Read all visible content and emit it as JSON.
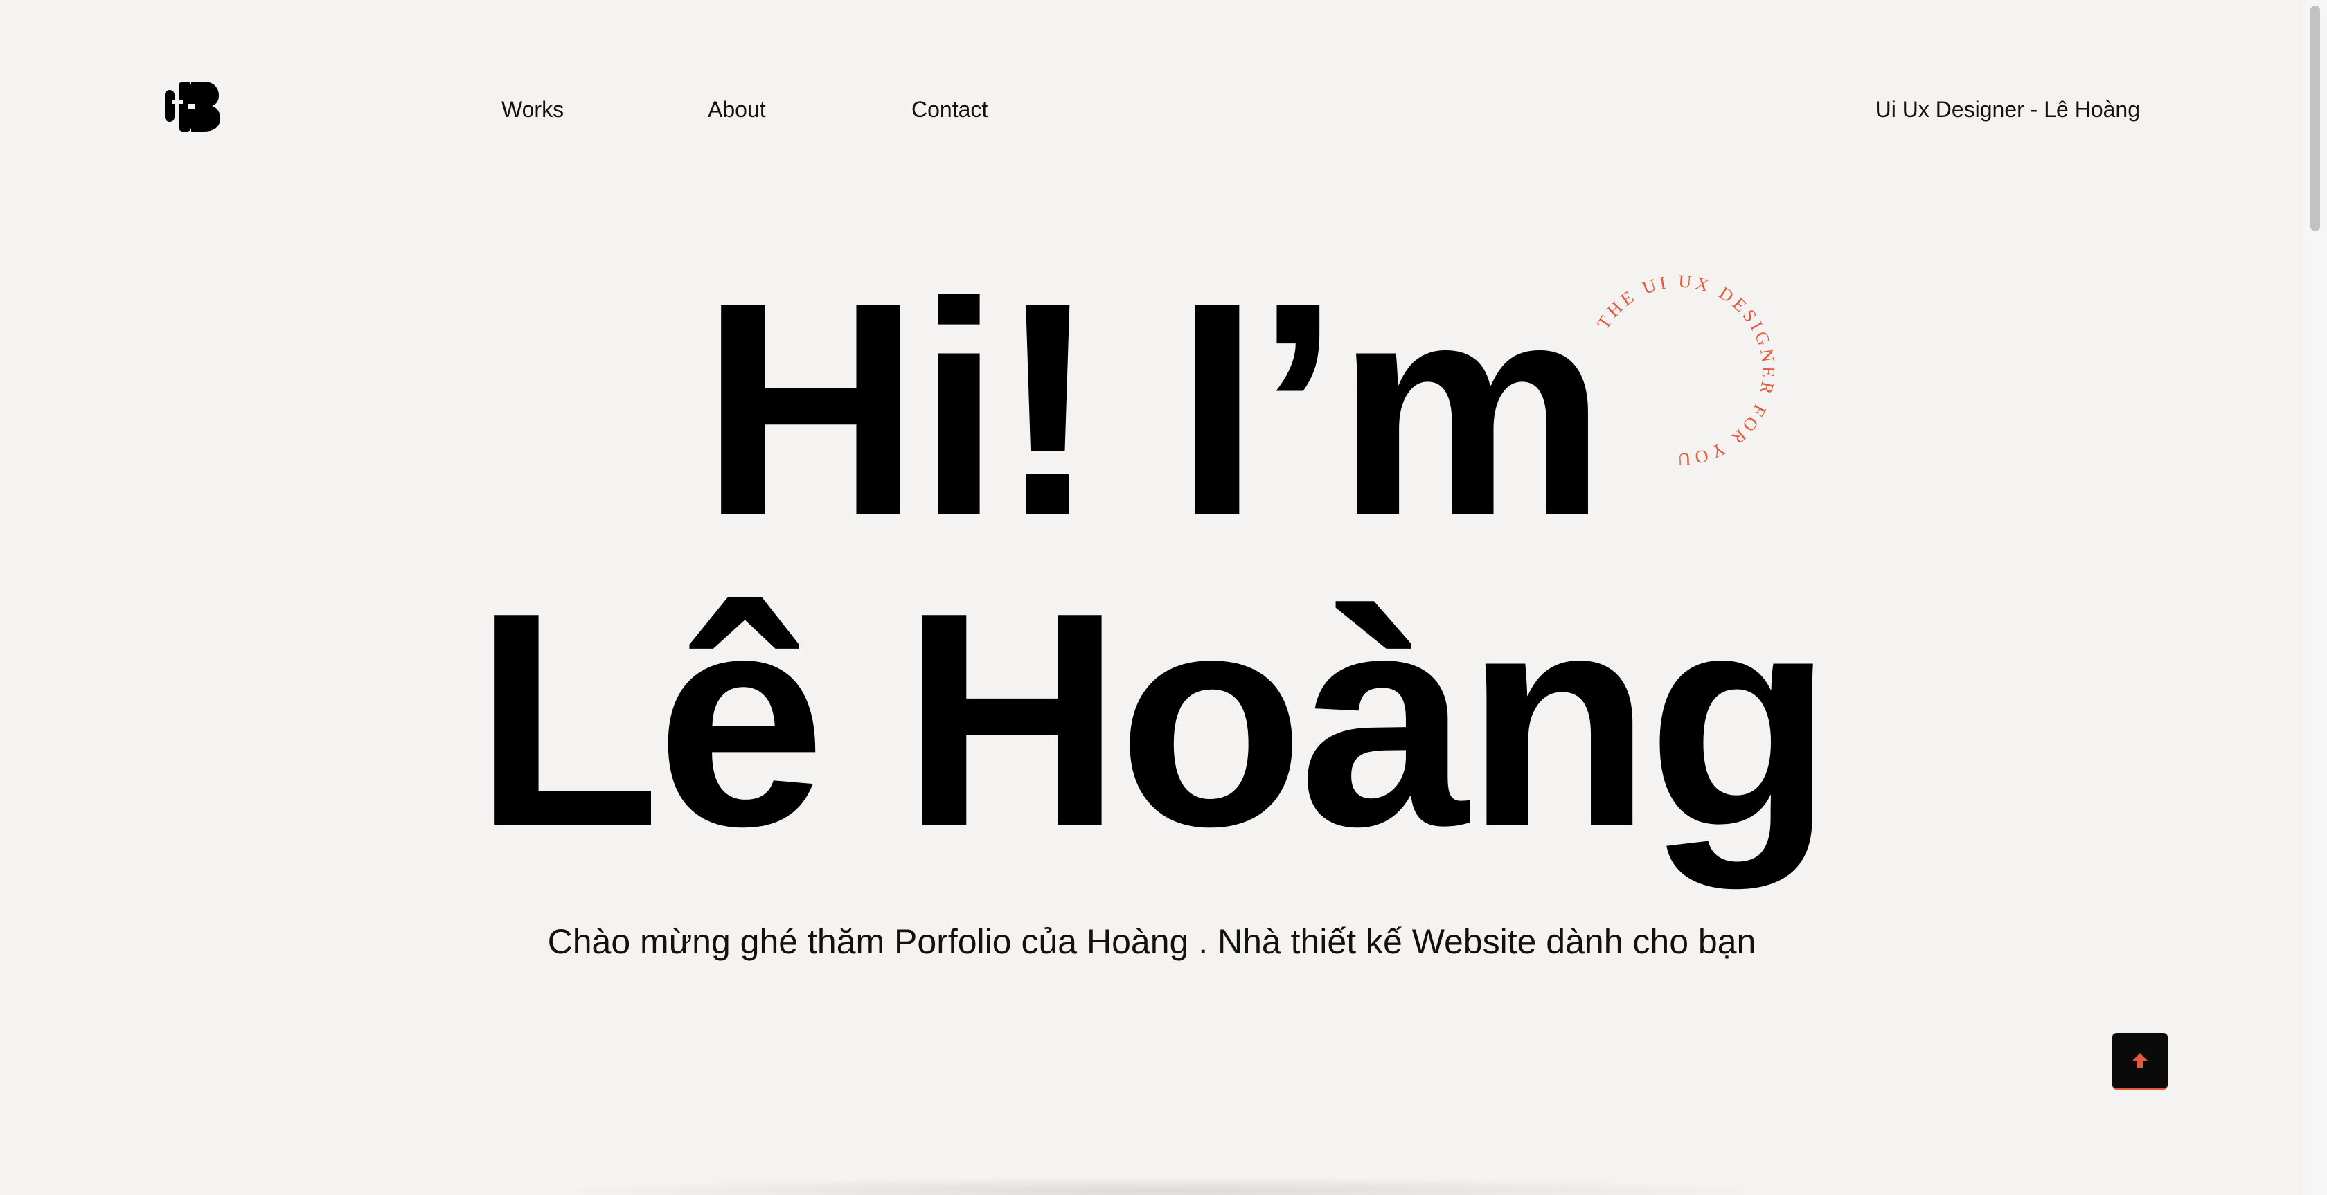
{
  "header": {
    "logo_icon": "hb-monogram-logo",
    "nav": [
      {
        "label": "Works"
      },
      {
        "label": "About"
      },
      {
        "label": "Contact"
      }
    ],
    "tagline": "Ui Ux Designer - Lê Hoàng"
  },
  "hero": {
    "line1": "Hi! I’m",
    "line2": "Lê Hoàng",
    "subtitle": "Chào mừng ghé thăm Porfolio của Hoàng . Nhà thiết kế Website dành cho bạn",
    "badge_text": "THE UI UX DESIGNER FOR YOU"
  },
  "scroll_top": {
    "icon": "arrow-up-icon"
  },
  "colors": {
    "background": "#f4f3f1",
    "text": "#000000",
    "accent": "#e2593c"
  }
}
